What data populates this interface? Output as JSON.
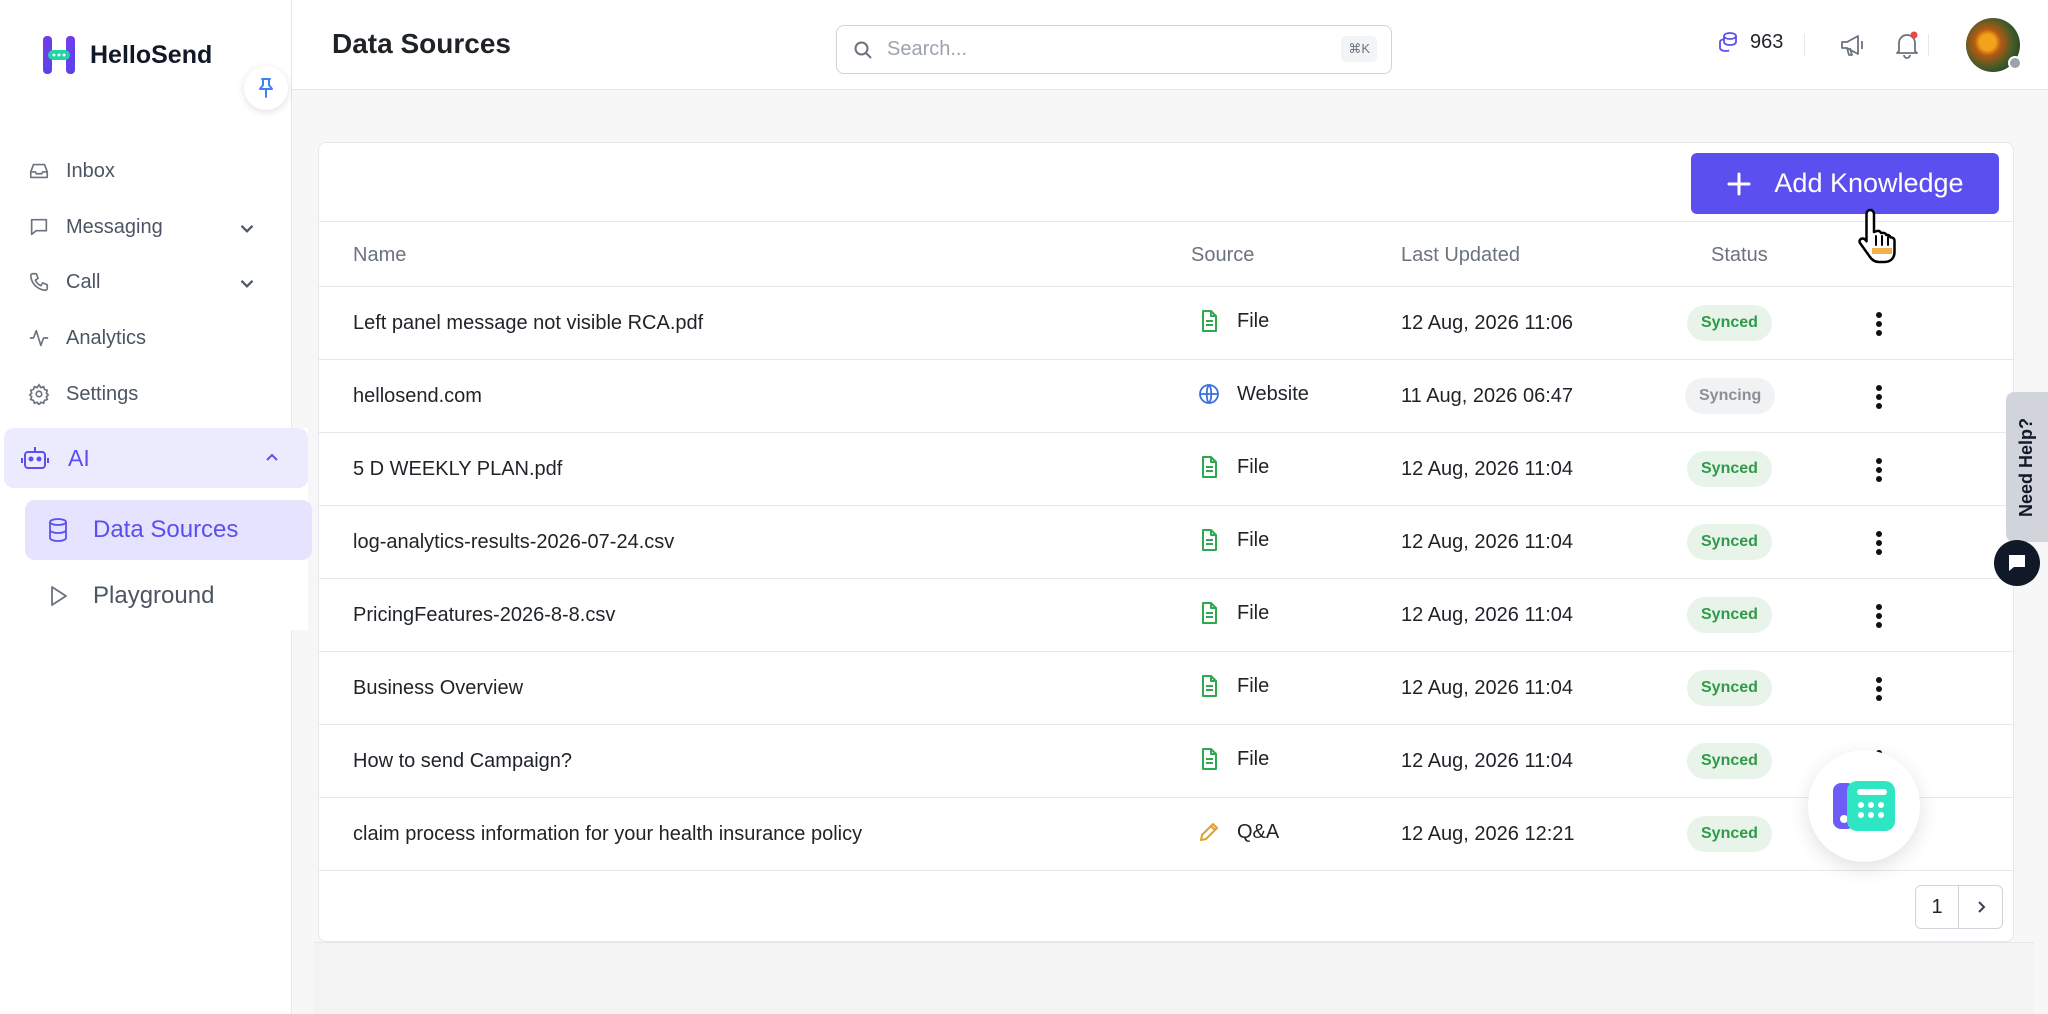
{
  "brand": {
    "name": "HelloSend"
  },
  "sidebar": {
    "items": [
      {
        "label": "Inbox",
        "icon": "inbox-icon"
      },
      {
        "label": "Messaging",
        "icon": "message-icon"
      },
      {
        "label": "Call",
        "icon": "phone-icon"
      },
      {
        "label": "Analytics",
        "icon": "analytics-icon"
      },
      {
        "label": "Settings",
        "icon": "gear-icon"
      }
    ],
    "ai": {
      "label": "AI",
      "children": [
        {
          "label": "Data Sources",
          "active": true
        },
        {
          "label": "Playground",
          "active": false
        }
      ]
    }
  },
  "header": {
    "title": "Data Sources",
    "search_placeholder": "Search...",
    "search_shortcut": "⌘K",
    "credits": "963"
  },
  "toolbar": {
    "add_label": "Add Knowledge"
  },
  "table": {
    "columns": [
      "Name",
      "Source",
      "Last Updated",
      "Status"
    ],
    "rows": [
      {
        "name": "Left panel message not visible RCA.pdf",
        "source": "File",
        "updated": "12 Aug, 2026 11:06",
        "status": "Synced"
      },
      {
        "name": "hellosend.com",
        "source": "Website",
        "updated": "11 Aug, 2026 06:47",
        "status": "Syncing"
      },
      {
        "name": "5 D WEEKLY PLAN.pdf",
        "source": "File",
        "updated": "12 Aug, 2026 11:04",
        "status": "Synced"
      },
      {
        "name": "log-analytics-results-2026-07-24.csv",
        "source": "File",
        "updated": "12 Aug, 2026 11:04",
        "status": "Synced"
      },
      {
        "name": "PricingFeatures-2026-8-8.csv",
        "source": "File",
        "updated": "12 Aug, 2026 11:04",
        "status": "Synced"
      },
      {
        "name": "Business Overview",
        "source": "File",
        "updated": "12 Aug, 2026 11:04",
        "status": "Synced"
      },
      {
        "name": "How to send Campaign?",
        "source": "File",
        "updated": "12 Aug, 2026 11:04",
        "status": "Synced"
      },
      {
        "name": "claim process information for your health insurance policy",
        "source": "Q&A",
        "updated": "12 Aug, 2026 12:21",
        "status": "Synced"
      }
    ]
  },
  "pagination": {
    "current_page": "1"
  },
  "help": {
    "label": "Need Help?"
  },
  "colors": {
    "accent": "#5b4ff0",
    "synced": "#2f9a48",
    "file_icon": "#2fa84f",
    "website_icon": "#3b6fe0",
    "qa_icon": "#e0a02a"
  }
}
